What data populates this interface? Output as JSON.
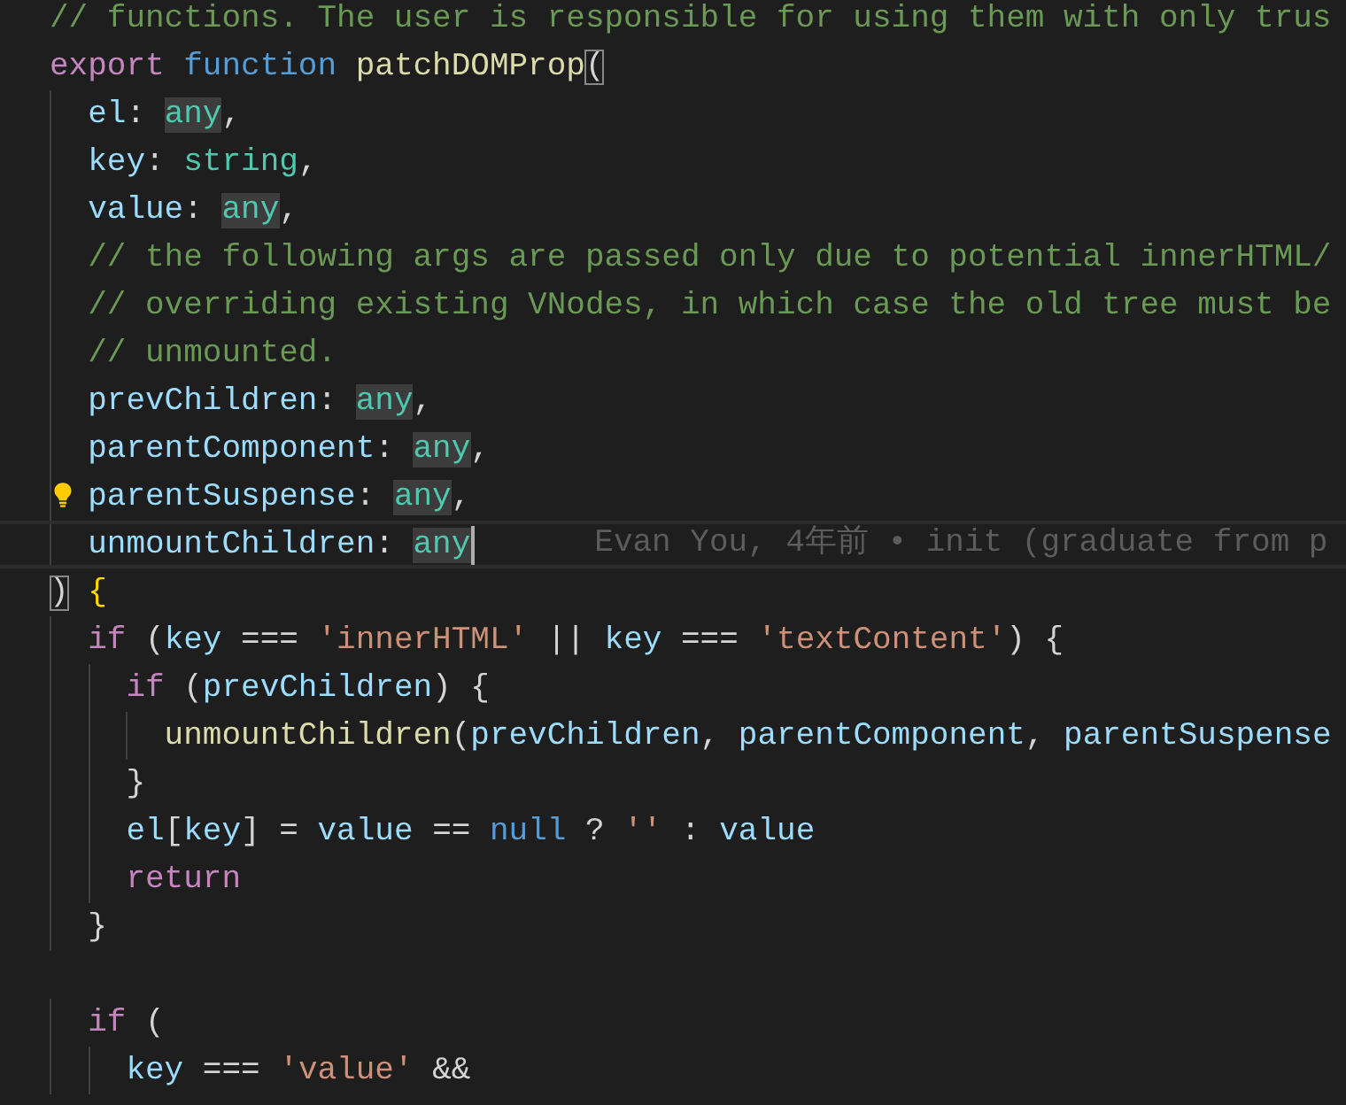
{
  "editor": {
    "lines": [
      {
        "current": false,
        "lightbulb": false,
        "tokens": [
          {
            "text": "// functions. The user is responsible for using them with only trus",
            "kind": "comment"
          }
        ]
      },
      {
        "current": false,
        "lightbulb": false,
        "tokens": [
          {
            "text": "export ",
            "kind": "keyword"
          },
          {
            "text": "function ",
            "kind": "storage"
          },
          {
            "text": "patchDOMProp",
            "kind": "function"
          },
          {
            "text": "(",
            "kind": "bracket_match"
          }
        ]
      },
      {
        "current": false,
        "lightbulb": false,
        "tokens": [
          {
            "text": "  el",
            "kind": "param"
          },
          {
            "text": ": ",
            "kind": "plain"
          },
          {
            "text": "any",
            "kind": "type_highlighted"
          },
          {
            "text": ",",
            "kind": "plain"
          }
        ]
      },
      {
        "current": false,
        "lightbulb": false,
        "tokens": [
          {
            "text": "  key",
            "kind": "param"
          },
          {
            "text": ": ",
            "kind": "plain"
          },
          {
            "text": "string",
            "kind": "type"
          },
          {
            "text": ",",
            "kind": "plain"
          }
        ]
      },
      {
        "current": false,
        "lightbulb": false,
        "tokens": [
          {
            "text": "  value",
            "kind": "param"
          },
          {
            "text": ": ",
            "kind": "plain"
          },
          {
            "text": "any",
            "kind": "type_highlighted"
          },
          {
            "text": ",",
            "kind": "plain"
          }
        ]
      },
      {
        "current": false,
        "lightbulb": false,
        "tokens": [
          {
            "text": "  // the following args are passed only due to potential innerHTML/",
            "kind": "comment"
          }
        ]
      },
      {
        "current": false,
        "lightbulb": false,
        "tokens": [
          {
            "text": "  // overriding existing VNodes, in which case the old tree must be",
            "kind": "comment"
          }
        ]
      },
      {
        "current": false,
        "lightbulb": false,
        "tokens": [
          {
            "text": "  // unmounted.",
            "kind": "comment"
          }
        ]
      },
      {
        "current": false,
        "lightbulb": false,
        "tokens": [
          {
            "text": "  prevChildren",
            "kind": "param"
          },
          {
            "text": ": ",
            "kind": "plain"
          },
          {
            "text": "any",
            "kind": "type_highlighted"
          },
          {
            "text": ",",
            "kind": "plain"
          }
        ]
      },
      {
        "current": false,
        "lightbulb": false,
        "tokens": [
          {
            "text": "  parentComponent",
            "kind": "param"
          },
          {
            "text": ": ",
            "kind": "plain"
          },
          {
            "text": "any",
            "kind": "type_highlighted"
          },
          {
            "text": ",",
            "kind": "plain"
          }
        ]
      },
      {
        "current": false,
        "lightbulb": true,
        "tokens": [
          {
            "text": "  parentSuspense",
            "kind": "param"
          },
          {
            "text": ": ",
            "kind": "plain"
          },
          {
            "text": "any",
            "kind": "type_highlighted"
          },
          {
            "text": ",",
            "kind": "plain"
          }
        ]
      },
      {
        "current": true,
        "lightbulb": false,
        "blame": "Evan You, 4年前 • init (graduate from p",
        "tokens": [
          {
            "text": "  unmountChildren",
            "kind": "param"
          },
          {
            "text": ": ",
            "kind": "plain"
          },
          {
            "text": "any",
            "kind": "type_highlighted"
          }
        ]
      },
      {
        "current": false,
        "lightbulb": false,
        "tokens": [
          {
            "text": ")",
            "kind": "bracket_match"
          },
          {
            "text": " {",
            "kind": "bracket"
          }
        ]
      },
      {
        "current": false,
        "lightbulb": false,
        "tokens": [
          {
            "text": "  if",
            "kind": "keyword"
          },
          {
            "text": " (",
            "kind": "plain"
          },
          {
            "text": "key",
            "kind": "param"
          },
          {
            "text": " === ",
            "kind": "plain"
          },
          {
            "text": "'innerHTML'",
            "kind": "string"
          },
          {
            "text": " || ",
            "kind": "plain"
          },
          {
            "text": "key",
            "kind": "param"
          },
          {
            "text": " === ",
            "kind": "plain"
          },
          {
            "text": "'textContent'",
            "kind": "string"
          },
          {
            "text": ") {",
            "kind": "plain"
          }
        ]
      },
      {
        "current": false,
        "lightbulb": false,
        "tokens": [
          {
            "text": "    if",
            "kind": "keyword"
          },
          {
            "text": " (",
            "kind": "plain"
          },
          {
            "text": "prevChildren",
            "kind": "param"
          },
          {
            "text": ") {",
            "kind": "plain"
          }
        ]
      },
      {
        "current": false,
        "lightbulb": false,
        "tokens": [
          {
            "text": "      unmountChildren",
            "kind": "function"
          },
          {
            "text": "(",
            "kind": "plain"
          },
          {
            "text": "prevChildren",
            "kind": "param"
          },
          {
            "text": ", ",
            "kind": "plain"
          },
          {
            "text": "parentComponent",
            "kind": "param"
          },
          {
            "text": ", ",
            "kind": "plain"
          },
          {
            "text": "parentSuspense",
            "kind": "param"
          }
        ]
      },
      {
        "current": false,
        "lightbulb": false,
        "tokens": [
          {
            "text": "    }",
            "kind": "plain"
          }
        ]
      },
      {
        "current": false,
        "lightbulb": false,
        "tokens": [
          {
            "text": "    el",
            "kind": "param"
          },
          {
            "text": "[",
            "kind": "plain"
          },
          {
            "text": "key",
            "kind": "param"
          },
          {
            "text": "] = ",
            "kind": "plain"
          },
          {
            "text": "value",
            "kind": "param"
          },
          {
            "text": " == ",
            "kind": "plain"
          },
          {
            "text": "null",
            "kind": "storage"
          },
          {
            "text": " ? ",
            "kind": "plain"
          },
          {
            "text": "''",
            "kind": "string"
          },
          {
            "text": " : ",
            "kind": "plain"
          },
          {
            "text": "value",
            "kind": "param"
          }
        ]
      },
      {
        "current": false,
        "lightbulb": false,
        "tokens": [
          {
            "text": "    return",
            "kind": "keyword"
          }
        ]
      },
      {
        "current": false,
        "lightbulb": false,
        "tokens": [
          {
            "text": "  }",
            "kind": "plain"
          }
        ]
      },
      {
        "current": false,
        "lightbulb": false
      },
      {
        "current": false,
        "lightbulb": false,
        "tokens": [
          {
            "text": "  if",
            "kind": "keyword"
          },
          {
            "text": " (",
            "kind": "plain"
          }
        ]
      },
      {
        "current": false,
        "lightbulb": false,
        "tokens": [
          {
            "text": "    key",
            "kind": "param"
          },
          {
            "text": " === ",
            "kind": "plain"
          },
          {
            "text": "'value'",
            "kind": "string"
          },
          {
            "text": " &&",
            "kind": "plain"
          }
        ]
      }
    ]
  }
}
